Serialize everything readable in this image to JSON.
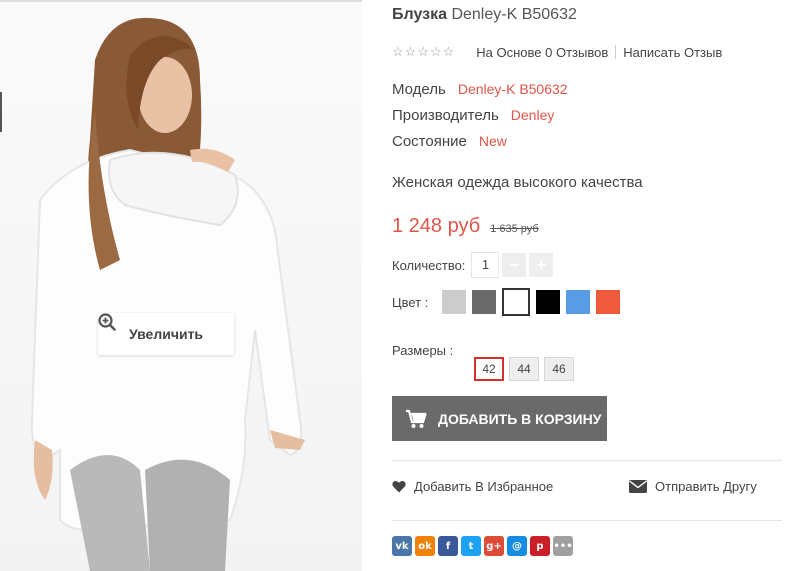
{
  "product": {
    "title_main": "Блузка",
    "title_model": "Denley-K B50632",
    "rating_stars": 0,
    "reviews_link": "На Основе 0 Отзывов",
    "write_review": "Написать Отзыв",
    "specs": [
      {
        "label": "Модель",
        "value": "Denley-K B50632"
      },
      {
        "label": "Производитель",
        "value": "Denley"
      },
      {
        "label": "Состояние",
        "value": "New"
      }
    ],
    "description": "Женская одежда высокого качества",
    "price": "1 248 руб",
    "old_price": "1 635 руб",
    "quantity_label": "Количество:",
    "quantity_value": "1",
    "minus": "−",
    "plus": "+",
    "color_label": "Цвет :",
    "colors": [
      "#cccccc",
      "#696969",
      "#ffffff",
      "#000000",
      "#5a9be6",
      "#f05a3c"
    ],
    "selected_color_index": 2,
    "sizes_label": "Размеры :",
    "sizes": [
      "42",
      "44",
      "46"
    ],
    "selected_size": "42",
    "add_to_cart": "ДОБАВИТЬ В КОРЗИНУ",
    "wishlist": "Добавить В Избранное",
    "send_friend": "Отправить Другу"
  },
  "image": {
    "zoom_label": "Увеличить"
  },
  "social": [
    {
      "name": "vk",
      "glyph": "vk",
      "color": "#4a76a8"
    },
    {
      "name": "odnoklassniki",
      "glyph": "ok",
      "color": "#ee8208"
    },
    {
      "name": "facebook",
      "glyph": "f",
      "color": "#3b5998"
    },
    {
      "name": "twitter",
      "glyph": "t",
      "color": "#1da1f2"
    },
    {
      "name": "google-plus",
      "glyph": "g+",
      "color": "#dd4b39"
    },
    {
      "name": "mail",
      "glyph": "@",
      "color": "#168de2"
    },
    {
      "name": "pinterest",
      "glyph": "p",
      "color": "#cb2027"
    },
    {
      "name": "more",
      "glyph": "•••",
      "color": "#a0a0a0"
    }
  ]
}
